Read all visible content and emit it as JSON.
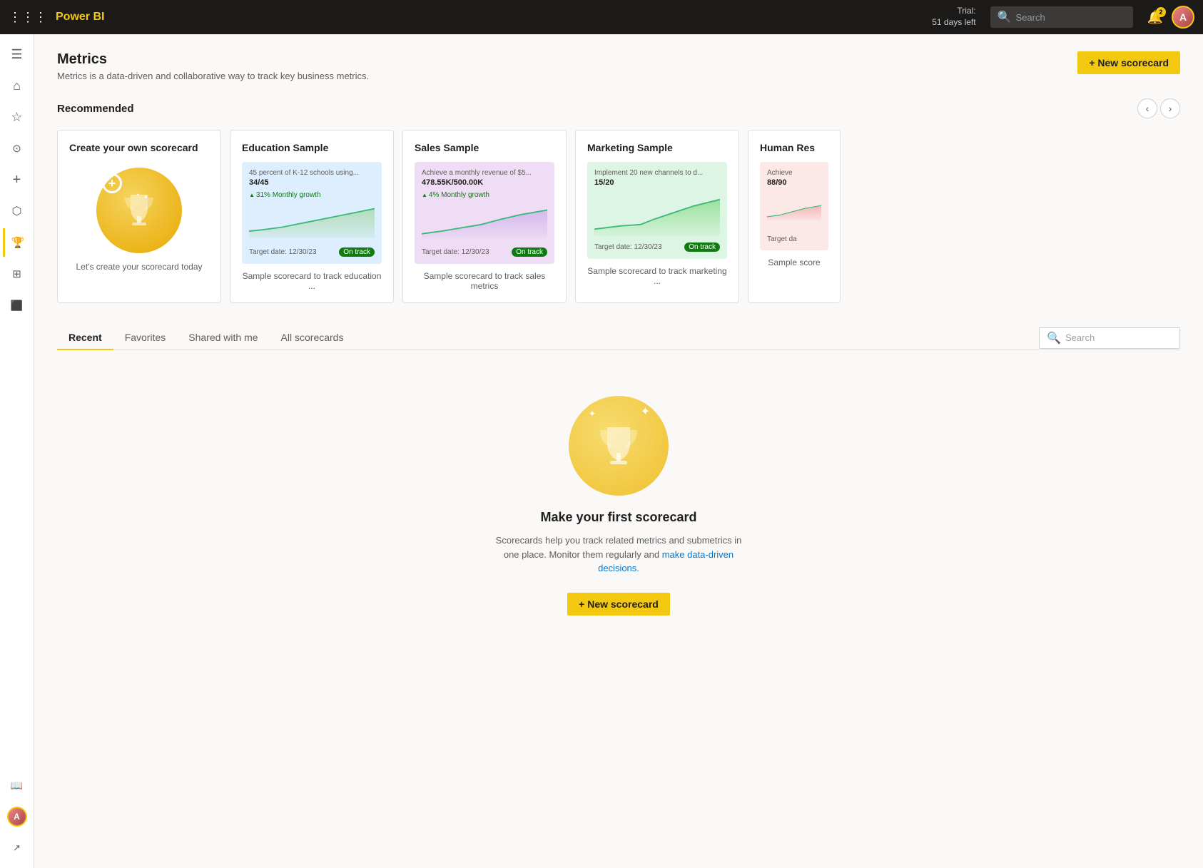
{
  "topnav": {
    "grid_icon": "⋮⋮⋮",
    "logo": "Power BI",
    "trial_line1": "Trial:",
    "trial_line2": "51 days left",
    "search_placeholder": "Search",
    "notif_count": "2",
    "avatar_letter": "A"
  },
  "page": {
    "title": "Metrics",
    "subtitle": "Metrics is a data-driven and collaborative way to track key business metrics.",
    "new_scorecard_btn": "+ New scorecard"
  },
  "recommended": {
    "title": "Recommended",
    "cards": [
      {
        "id": "create",
        "title": "Create your own scorecard",
        "desc": "Let's create your scorecard today",
        "type": "create"
      },
      {
        "id": "education",
        "title": "Education Sample",
        "preview_title": "45 percent of K-12 schools using...",
        "preview_value": "34/45",
        "growth_text": "31% Monthly growth",
        "target_date": "Target date: 12/30/23",
        "status": "On track",
        "desc": "Sample scorecard to track education ...",
        "theme": "blue"
      },
      {
        "id": "sales",
        "title": "Sales Sample",
        "preview_title": "Achieve a monthly revenue of $5...",
        "preview_value": "478.55K/500.00K",
        "growth_text": "4% Monthly growth",
        "target_date": "Target date: 12/30/23",
        "status": "On track",
        "desc": "Sample scorecard to track sales metrics",
        "theme": "purple"
      },
      {
        "id": "marketing",
        "title": "Marketing Sample",
        "preview_title": "Implement 20 new channels to d...",
        "preview_value": "15/20",
        "growth_text": "",
        "target_date": "Target date: 12/30/23",
        "status": "On track",
        "desc": "Sample scorecard to track marketing ...",
        "theme": "green"
      },
      {
        "id": "human",
        "title": "Human Res",
        "preview_title": "Achieve",
        "preview_value": "88/90",
        "target_date": "Target da",
        "desc": "Sample score",
        "theme": "pink",
        "truncated": true
      }
    ]
  },
  "tabs": {
    "items": [
      {
        "id": "recent",
        "label": "Recent",
        "active": true
      },
      {
        "id": "favorites",
        "label": "Favorites",
        "active": false
      },
      {
        "id": "shared",
        "label": "Shared with me",
        "active": false
      },
      {
        "id": "all",
        "label": "All scorecards",
        "active": false
      }
    ],
    "search_placeholder": "Search"
  },
  "empty_state": {
    "title": "Make your first scorecard",
    "desc_line1": "Scorecards help you track related metrics and submetrics in one",
    "desc_line2": "place. Monitor them regularly and make data-driven decisions.",
    "new_scorecard_btn": "+ New scorecard"
  },
  "sidebar": {
    "items": [
      {
        "id": "hamburger",
        "icon": "☰",
        "label": "Menu"
      },
      {
        "id": "home",
        "icon": "⌂",
        "label": "Home"
      },
      {
        "id": "favorites",
        "icon": "☆",
        "label": "Favorites"
      },
      {
        "id": "recent",
        "icon": "⏱",
        "label": "Recent"
      },
      {
        "id": "create",
        "icon": "+",
        "label": "Create"
      },
      {
        "id": "datahub",
        "icon": "⬡",
        "label": "Data hub"
      },
      {
        "id": "metrics",
        "icon": "🏆",
        "label": "Metrics",
        "active": true
      },
      {
        "id": "monitoring",
        "icon": "⊞",
        "label": "Monitoring hub"
      },
      {
        "id": "apps",
        "icon": "⬛",
        "label": "Apps"
      },
      {
        "id": "learn",
        "icon": "📖",
        "label": "Learn"
      }
    ]
  }
}
